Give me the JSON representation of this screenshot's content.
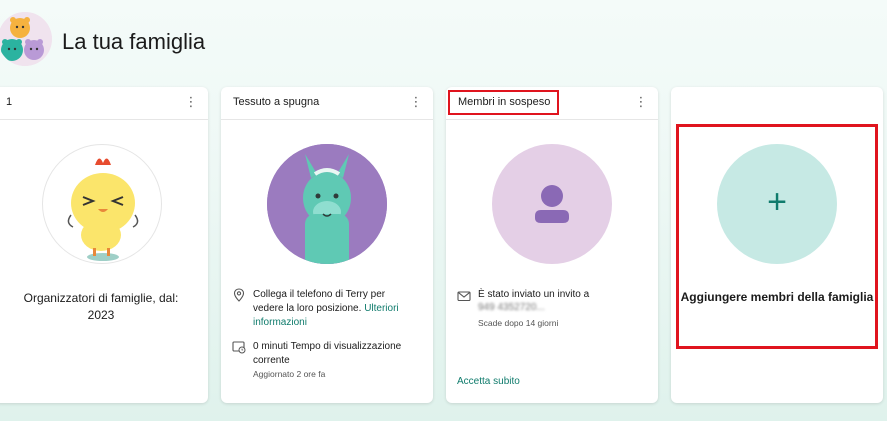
{
  "header": {
    "title": "La tua famiglia"
  },
  "cards": [
    {
      "title": "1",
      "subtitle_line1": "Organizzatori di famiglie, dal:",
      "subtitle_line2": "2023"
    },
    {
      "title": "Tessuto a spugna",
      "location_text": "Collega il telefono di Terry per vedere la loro posizione.",
      "location_link": "Ulteriori informazioni",
      "screen_time_text": "0 minuti Tempo di visualizzazione corrente",
      "screen_time_updated": "Aggiornato 2 ore fa"
    },
    {
      "title": "Membri in sospeso",
      "invite_text": "È stato inviato un invito a",
      "invite_email": "949 4352720...",
      "expires_text": "Scade dopo 14 giorni",
      "accept_link": "Accetta subito"
    },
    {
      "add_label": "Aggiungere membri della famiglia",
      "add_symbol": "+"
    }
  ],
  "icons": {
    "more": "more-vertical-icon",
    "location": "location-pin-icon",
    "screen_time": "screen-time-icon",
    "mail": "mail-icon",
    "add": "plus-icon"
  },
  "colors": {
    "accent": "#0f7b6c",
    "highlight": "#e0141e",
    "add_circle": "#c6e9e4",
    "pending_circle": "#e4cfe6",
    "llama_bg": "#9b7bbf"
  }
}
